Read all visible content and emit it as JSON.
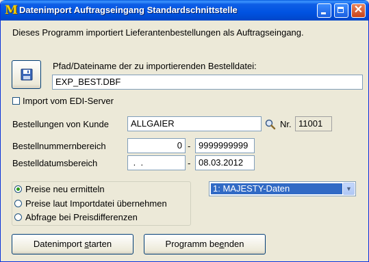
{
  "window": {
    "app_icon": "M",
    "title": "Datenimport Auftragseingang Standardschnittstelle",
    "controls": {
      "minimize": "minimize-icon",
      "maximize": "maximize-icon",
      "close": "close-icon",
      "close_glyph": "✕"
    }
  },
  "intro": "Dieses Programm importiert Lieferantenbestellungen als Auftragseingang.",
  "file": {
    "label": "Pfad/Dateiname der zu importierenden Bestelldatei:",
    "value": "EXP_BEST.DBF",
    "save_icon": "floppy-disk-icon"
  },
  "edi": {
    "label": "Import vom EDI-Server",
    "checked": false
  },
  "customer": {
    "label": "Bestellungen von Kunde",
    "value": "ALLGAIER",
    "search_icon": "search-icon",
    "nr_label": "Nr.",
    "nr_value": "11001"
  },
  "order_range": {
    "label": "Bestellnummernbereich",
    "from": "0",
    "separator": "-",
    "to": "9999999999"
  },
  "date_range": {
    "label": "Bestelldatumsbereich",
    "from": " .  .",
    "separator": "-",
    "to": "08.03.2012"
  },
  "price_options": [
    {
      "label": "Preise neu ermitteln",
      "selected": true
    },
    {
      "label": "Preise laut Importdatei übernehmen",
      "selected": false
    },
    {
      "label": "Abfrage bei Preisdifferenzen",
      "selected": false
    }
  ],
  "source_select": {
    "value": "1: MAJESTY-Daten",
    "arrow": "▼"
  },
  "buttons": {
    "start": {
      "pre": "Datenimport ",
      "mnemonic": "s",
      "post": "tarten"
    },
    "end": {
      "pre": "Programm be",
      "mnemonic": "e",
      "post": "nden"
    }
  }
}
